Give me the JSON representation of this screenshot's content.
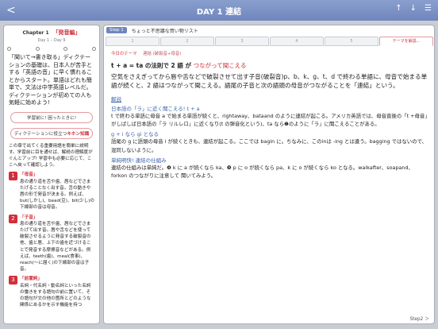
{
  "topbar": {
    "title": "DAY 1 連結",
    "back_icon": "<",
    "icons": [
      "↑",
      "↓",
      "☰"
    ]
  },
  "left": {
    "chapter": "Chapter 1",
    "chapter_name": "「発音編」",
    "days": "Day 1 – Day 9",
    "intro": "「聞いて→書き取る」ディクテーションの基礎は、日本人が苦手とする「英語の音」に早く慣れることからスタート。単語はどれも簡単で、文法は中学英語レベルだ。ディクテーションが初めての人も気軽に始めよう!",
    "pill1": "学習前に! 困ったときに!",
    "pill2_a": "ディクテーションに役立つ",
    "pill2_b": "キホン知識",
    "para": "この章で出てくる重要用語を簡単に説明す。学習前に目を通せば、解説の理解度がぐんとアップ! 学習中も必要に応じて、ここへ戻って確認しよう。",
    "items": [
      {
        "num": "1",
        "title": "「母音」",
        "body": "息の通り道を舌や歯、唇などでさまたげることなく出す音。舌の動きや唇の形で発音が決まる。例えば、but(しかし)、bead(豆)、bit(少し)の下線部の音は母音。"
      },
      {
        "num": "2",
        "title": "「子音」",
        "body": "息の通り道を舌や歯、唇などでさまたげて出す音。唇や舌などを使って破裂させるように発音する破裂音の他、歯と唇、上下の歯を近づけることで発音する摩擦音などがある。例えば、teeth(歯)、meal(食事)、reach(～に届く)の下線部の音は子音。"
      },
      {
        "num": "3",
        "title": "「前置詞」",
        "body": "名詞・代名詞・動名詞といった名詞の働きをする語句の前に置いて、その語句が文の他の箇所とどのような関係にあるかを示す機能を持つ"
      }
    ]
  },
  "right": {
    "step_tag": "Step 1",
    "step_title": "ちょっと不思議な買い物リスト",
    "tabs": [
      "1",
      "2",
      "3",
      "4",
      "5",
      "テーマを解説..."
    ],
    "theme_label": "今日のテーマ",
    "theme_value": "連結 (破裂音+母音)",
    "headline_a": "t + a = ta の法則で 2 語 が",
    "headline_b": "つながって聞こえる",
    "body": "空気をさえぎってから唇や舌などで破裂させて出す子音(破裂音)p、b、k、g、t、d で終わる単語に、母音で始まる単語が続くと、2 語はつながって聞こえる。語尾の子音と次の語頭の母音がつながることを「連結」という。",
    "section": "解説",
    "sub1": "日本語の「ラ」に近く聞こえる! t + a",
    "p1": "t で終わる単語に母音 a で始まる単語が続くと、rightaway、bataand のように連結が起こる。アメリカ英語では、母音直後の「t +母音」がしばしば日本語の「ラ リルレロ」に近くなり(t の弾音化という)、ta なら❶のように「ラ」に聞こえることがある。",
    "sub2": "g + i なら gi となる",
    "p2": "語尾の g に語頭の母音 i が続くときも、連結が起こる。ここでは bagin に。ちなみに、このinは -ing とは違う。bagging ではないので、混同しないように。",
    "sub3": "単純明快! 連結の仕組み",
    "p3": "連結の仕組みは単純だ。❹ k に a が続くなら ka、❺ p に o が続くなら pa、k に o が続くなら ko となる。walkafter、soapand、forkon のつながりに注意して 聞いてみよう。",
    "step_foot": "Step2 ＞"
  }
}
